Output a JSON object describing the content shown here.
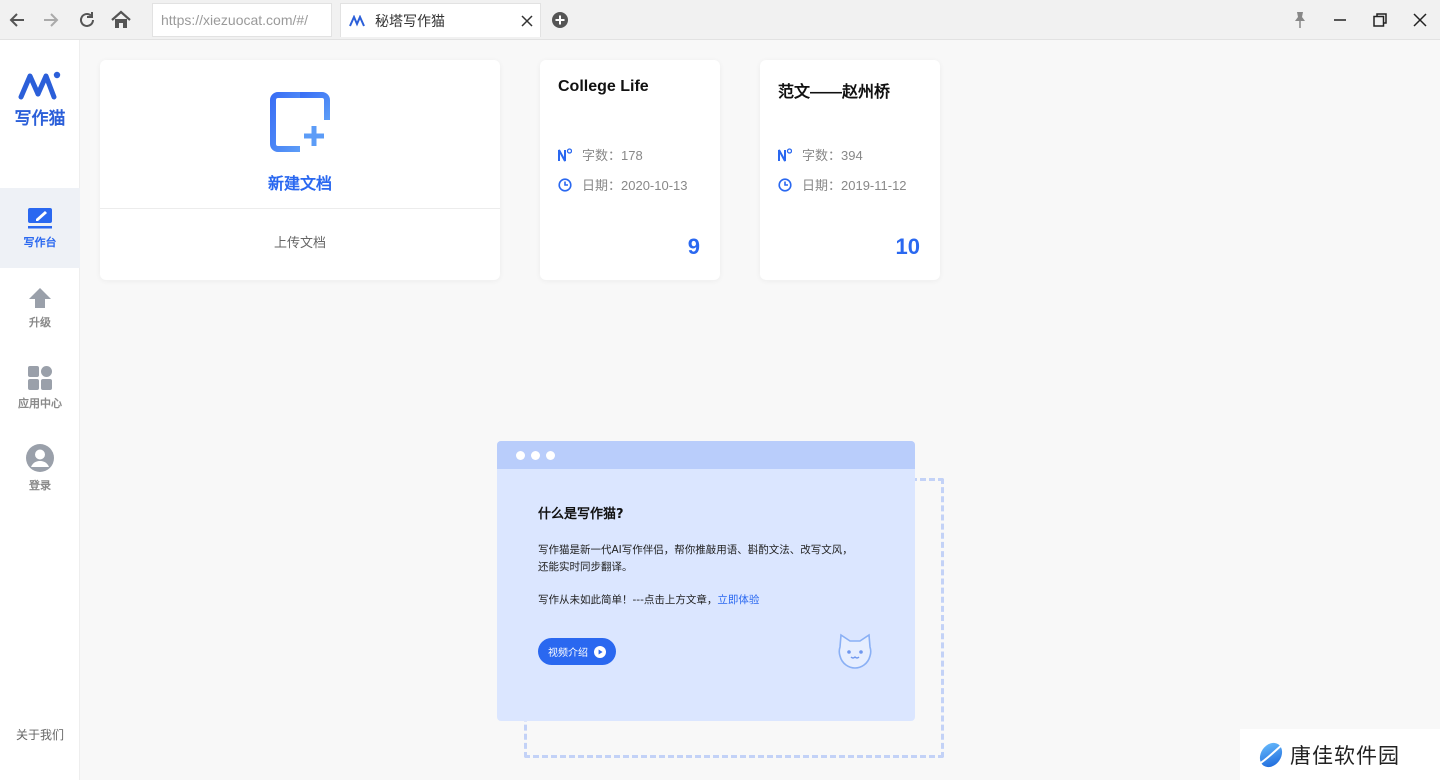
{
  "browser": {
    "url": "https://xiezuocat.com/#/",
    "tab_title": "秘塔写作猫"
  },
  "sidebar": {
    "logo_text": "写作猫",
    "items": [
      {
        "label": "写作台",
        "icon": "edit-icon",
        "active": true
      },
      {
        "label": "升级",
        "icon": "upload-arrow-icon",
        "active": false
      },
      {
        "label": "应用中心",
        "icon": "apps-grid-icon",
        "active": false
      },
      {
        "label": "登录",
        "icon": "user-icon",
        "active": false
      }
    ],
    "about": "关于我们"
  },
  "new_doc": {
    "label": "新建文档",
    "upload_label": "上传文档"
  },
  "documents": [
    {
      "title": "College Life",
      "words": "字数：178",
      "date": "日期：2020-10-13",
      "count": "9"
    },
    {
      "title": "范文——赵州桥",
      "words": "字数：394",
      "date": "日期：2019-11-12",
      "count": "10"
    }
  ],
  "intro": {
    "heading": "什么是写作猫?",
    "line1": "写作猫是新一代AI写作伴侣，帮你推敲用语、斟酌文法、改写文风，",
    "line2": "还能实时同步翻译。",
    "line3_prefix": "写作从未如此简单！---点击上方文章，",
    "line3_link": "立即体验",
    "video_button": "视频介绍"
  },
  "watermark": {
    "text": "唐佳软件园"
  },
  "colors": {
    "accent": "#2a68f0",
    "sidebar_active_bg": "#eef1f6",
    "intro_bg": "#dbe6ff",
    "intro_bar": "#b9cdfb"
  }
}
